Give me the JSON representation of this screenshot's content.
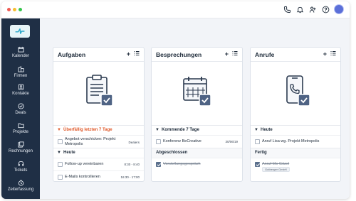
{
  "topbar": {
    "icons": [
      "phone-icon",
      "bell-icon",
      "people-icon",
      "help-icon",
      "avatar"
    ]
  },
  "sidebar": {
    "items": [
      {
        "label": "Kalender",
        "icon": "calendar-icon"
      },
      {
        "label": "Firmen",
        "icon": "building-icon"
      },
      {
        "label": "Kontakte",
        "icon": "contact-icon"
      },
      {
        "label": "Deals",
        "icon": "check-circle-icon"
      },
      {
        "label": "Projekte",
        "icon": "folder-icon"
      },
      {
        "label": "Rechnungen",
        "icon": "invoice-icon"
      },
      {
        "label": "Tickets",
        "icon": "headset-icon"
      },
      {
        "label": "Zeiterfassung",
        "icon": "clock-icon"
      }
    ]
  },
  "cards": {
    "aufgaben": {
      "title": "Aufgaben",
      "add": "+",
      "overdue_section": "Überfällig letzten 7 Tage",
      "overdue_rows": [
        {
          "text": "Angebot verschicken: Projekt Metropolis",
          "meta": "Dealers"
        }
      ],
      "today_section": "Heute",
      "today_rows": [
        {
          "text": "Follow-up vereinbaren",
          "meta": "8:30 - 8:40"
        },
        {
          "text": "E-Mails kontrollieren",
          "meta": "16:30 - 17:00"
        }
      ]
    },
    "besprechungen": {
      "title": "Besprechungen",
      "add": "+",
      "upcoming_section": "Kommende 7 Tage",
      "upcoming_rows": [
        {
          "text": "Konferenz BeCreative",
          "meta": "30/06/19"
        }
      ],
      "done_section": "Abgeschlossen",
      "done_rows": [
        {
          "text": "Vorstellungsgespräch"
        }
      ]
    },
    "anrufe": {
      "title": "Anrufe",
      "add": "+",
      "today_section": "Heute",
      "today_rows": [
        {
          "text": "Anruf Lisa wg. Projekt Metropolis"
        }
      ],
      "done_section": "Fertig",
      "done_rows": [
        {
          "text": "Anruf Mo Gözel",
          "chip": "Gutberger GmbH"
        }
      ]
    }
  },
  "colors": {
    "sidebar": "#1f2f45",
    "overdue": "#e0592a",
    "accent": "#5a6f8c"
  }
}
